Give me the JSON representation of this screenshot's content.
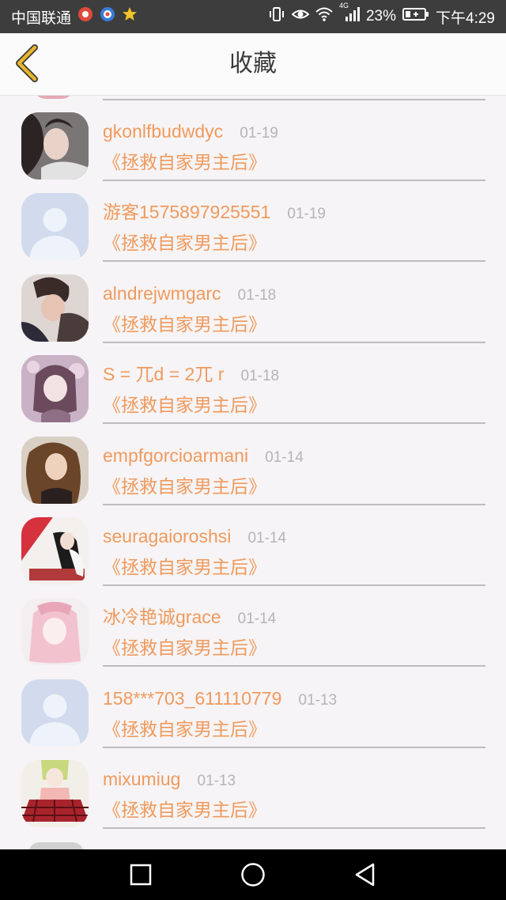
{
  "status_bar": {
    "carrier": "中国联通",
    "battery": "23%",
    "network_type": "4G",
    "time": "下午4:29",
    "icons": [
      "app-notification-icon",
      "browser-icon",
      "star-icon",
      "vibrate-icon",
      "eye-icon",
      "wifi-icon",
      "signal-icon",
      "battery-icon"
    ]
  },
  "app_bar": {
    "back_icon": "chevron-left-icon",
    "title": "收藏"
  },
  "favorites": [
    {
      "name": "gkonlfbudwdyc",
      "date": "01-19",
      "book": "《拯救自家男主后》",
      "avatar": "photo-girl-dark-hair"
    },
    {
      "name": "游客1575897925551",
      "date": "01-19",
      "book": "《拯救自家男主后》",
      "avatar": "default-placeholder"
    },
    {
      "name": "alndrejwmgarc",
      "date": "01-18",
      "book": "《拯救自家男主后》",
      "avatar": "photo-boy"
    },
    {
      "name": "S = 兀d = 2兀 r",
      "date": "01-18",
      "book": "《拯救自家男主后》",
      "avatar": "anime-girl-purple"
    },
    {
      "name": "empfgorcioarmani",
      "date": "01-14",
      "book": "《拯救自家男主后》",
      "avatar": "photo-curly-hair"
    },
    {
      "name": "seuragaioroshsi",
      "date": "01-14",
      "book": "《拯救自家男主后》",
      "avatar": "illustration-red"
    },
    {
      "name": "冰冷艳诚grace",
      "date": "01-14",
      "book": "《拯救自家男主后》",
      "avatar": "anime-girl-pink"
    },
    {
      "name": "158***703_611110779",
      "date": "01-13",
      "book": "《拯救自家男主后》",
      "avatar": "default-placeholder"
    },
    {
      "name": "mixumiug",
      "date": "01-13",
      "book": "《拯救自家男主后》",
      "avatar": "anime-girl-plaid"
    }
  ],
  "nav_bar": {
    "recent_icon": "square-recents-icon",
    "home_icon": "circle-home-icon",
    "back_icon": "triangle-back-icon"
  },
  "colors": {
    "accent": "#f09a5d",
    "back_arrow": "#e7b52b",
    "date": "#b5b5b5",
    "placeholder_avatar": "#d2dbed"
  }
}
